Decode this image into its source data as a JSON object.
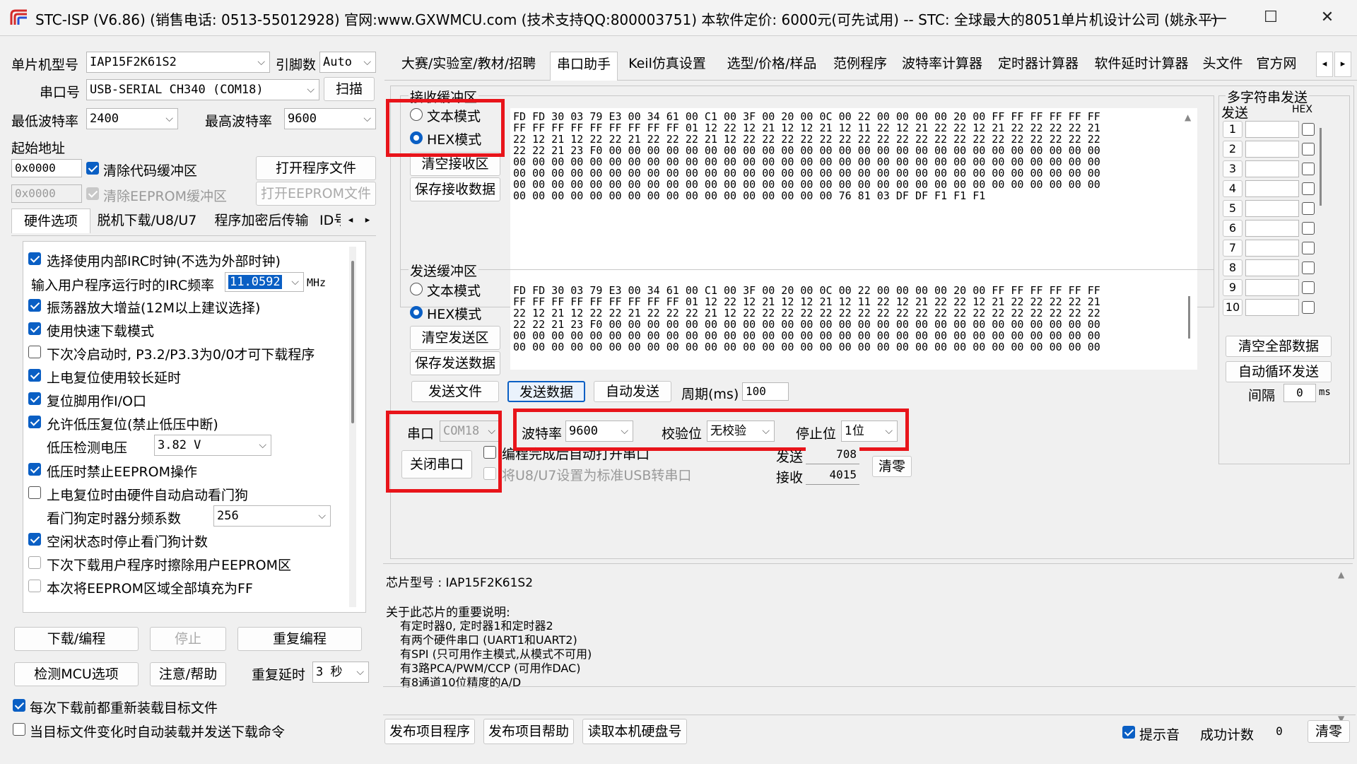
{
  "window": {
    "title": "STC-ISP (V6.86) (销售电话: 0513-55012928) 官网:www.GXWMCU.com  (技术支持QQ:800003751) 本软件定价: 6000元(可先试用) -- STC: 全球最大的8051单片机设计公司 (姚永平)",
    "minimize": "—",
    "maximize": "☐",
    "close": "✕"
  },
  "left": {
    "mcu_label": "单片机型号",
    "mcu_value": "IAP15F2K61S2",
    "pin_label": "引脚数",
    "pin_value": "Auto",
    "port_label": "串口号",
    "port_value": "USB-SERIAL CH340 (COM18)",
    "scan_button": "扫描",
    "min_baud_label": "最低波特率",
    "min_baud_value": "2400",
    "max_baud_label": "最高波特率",
    "max_baud_value": "9600",
    "start_addr_label": "起始地址",
    "addr1": "0x0000",
    "clear_code_label": "清除代码缓冲区",
    "open_program_button": "打开程序文件",
    "addr2": "0x0000",
    "clear_eeprom_label": "清除EEPROM缓冲区",
    "open_eeprom_button": "打开EEPROM文件",
    "tabs": [
      "硬件选项",
      "脱机下载/U8/U7",
      "程序加密后传输",
      "ID号"
    ],
    "options": [
      {
        "label": "选择使用内部IRC时钟(不选为外部时钟)",
        "checked": true
      },
      {
        "label": "振荡器放大增益(12M以上建议选择)",
        "checked": true
      },
      {
        "label": "使用快速下载模式",
        "checked": true
      },
      {
        "label": "下次冷启动时, P3.2/P3.3为0/0才可下载程序",
        "checked": false
      },
      {
        "label": "上电复位使用较长延时",
        "checked": true
      },
      {
        "label": "复位脚用作I/O口",
        "checked": true
      },
      {
        "label": "允许低压复位(禁止低压中断)",
        "checked": true
      },
      {
        "label": "低压时禁止EEPROM操作",
        "checked": true
      },
      {
        "label": "上电复位时由硬件自动启动看门狗",
        "checked": false
      },
      {
        "label": "空闲状态时停止看门狗计数",
        "checked": true
      },
      {
        "label": "下次下载用户程序时擦除用户EEPROM区",
        "checked": false
      },
      {
        "label": "本次将EEPROM区域全部填充为FF",
        "checked": false
      }
    ],
    "irc_label": "输入用户程序运行时的IRC频率",
    "irc_value": "11.0592",
    "irc_unit": "MHz",
    "lv_label": "低压检测电压",
    "lv_value": "3.82 V",
    "wdt_label": "看门狗定时器分频系数",
    "wdt_value": "256",
    "download_button": "下载/编程",
    "stop_button": "停止",
    "reprogram_button": "重复编程",
    "detect_button": "检测MCU选项",
    "help_button": "注意/帮助",
    "repeat_delay_label": "重复延时",
    "repeat_delay_value": "3 秒",
    "reload_label": "每次下载前都重新装载目标文件",
    "reload_checked": true,
    "autosend_label": "当目标文件变化时自动装载并发送下载命令",
    "autosend_checked": false
  },
  "right_tabs": [
    "大赛/实验室/教材/招聘",
    "串口助手",
    "Keil仿真设置",
    "选型/价格/样品",
    "范例程序",
    "波特率计算器",
    "定时器计算器",
    "软件延时计算器",
    "头文件",
    "官方网"
  ],
  "active_tab": 1,
  "receive": {
    "group_label": "接收缓冲区",
    "text_mode": "文本模式",
    "hex_mode": "HEX模式",
    "clear_button": "清空接收区",
    "save_button": "保存接收数据",
    "data": "FD FD 30 03 79 E3 00 34 61 00 C1 00 3F 00 20 00 0C 00 22 00 00 00 00 20 00 FF FF FF FF FF FF\nFF FF FF FF FF FF FF FF FF 01 12 22 12 21 12 12 21 12 11 22 12 21 22 22 12 21 22 22 22 22 21\n22 12 21 12 22 22 21 22 22 22 21 12 22 22 22 22 22 22 22 22 22 22 22 22 22 22 22 22 22 22 22\n22 22 21 23 F0 00 00 00 00 00 00 00 00 00 00 00 00 00 00 00 00 00 00 00 00 00 00 00 00 00 00\n00 00 00 00 00 00 00 00 00 00 00 00 00 00 00 00 00 00 00 00 00 00 00 00 00 00 00 00 00 00 00\n00 00 00 00 00 00 00 00 00 00 00 00 00 00 00 00 00 00 00 00 00 00 00 00 00 00 00 00 00 00 00\n00 00 00 00 00 00 00 00 00 00 00 00 00 00 00 00 00 00 00 00 00 00 00 00 00 00 00 00 00 00 00\n00 00 00 00 00 00 00 00 00 00 00 00 00 00 00 00 00 76 81 03 DF DF F1 F1 F1"
  },
  "send": {
    "group_label": "发送缓冲区",
    "text_mode": "文本模式",
    "hex_mode": "HEX模式",
    "clear_button": "清空发送区",
    "save_button": "保存发送数据",
    "data": "FD FD 30 03 79 E3 00 34 61 00 C1 00 3F 00 20 00 0C 00 22 00 00 00 00 20 00 FF FF FF FF FF FF\nFF FF FF FF FF FF FF FF FF 01 12 22 12 21 12 12 21 12 11 22 12 21 22 22 12 21 22 22 22 22 21\n22 12 21 12 22 22 21 22 22 22 21 12 22 22 22 22 22 22 22 22 22 22 22 22 22 22 22 22 22 22 22\n22 22 21 23 F0 00 00 00 00 00 00 00 00 00 00 00 00 00 00 00 00 00 00 00 00 00 00 00 00 00 00\n00 00 00 00 00 00 00 00 00 00 00 00 00 00 00 00 00 00 00 00 00 00 00 00 00 00 00 00 00 00 00\n00 00 00 00 00 00 00 00 00 00 00 00 00 00 00 00 00 00 00 00 00 00 00 00 00 00 00 00 00 00 00",
    "send_file_button": "发送文件",
    "send_data_button": "发送数据",
    "auto_send_button": "自动发送",
    "period_label": "周期(ms)",
    "period_value": "100"
  },
  "multi": {
    "title": "多字符串发送",
    "send_col": "发送",
    "hex_col": "HEX",
    "rows": [
      "1",
      "2",
      "3",
      "4",
      "5",
      "6",
      "7",
      "8",
      "9",
      "10"
    ],
    "clear_all_button": "清空全部数据",
    "loop_button": "自动循环发送",
    "interval_label": "间隔",
    "interval_value": "0",
    "interval_unit": "ms"
  },
  "serial": {
    "port_label": "串口",
    "port_value": "COM18",
    "close_button": "关闭串口",
    "baud_label": "波特率",
    "baud_value": "9600",
    "parity_label": "校验位",
    "parity_value": "无校验",
    "stop_label": "停止位",
    "stop_value": "1位",
    "auto_open_label": "编程完成后自动打开串口",
    "usb_label": "将U8/U7设置为标准USB转串口",
    "tx_label": "发送",
    "tx_value": "708",
    "rx_label": "接收",
    "rx_value": "4015",
    "clear_button": "清零"
  },
  "info": {
    "chip_line": "芯片型号 : IAP15F2K61S2",
    "notes_title": "关于此芯片的重要说明:",
    "notes": [
      "有定时器0, 定时器1和定时器2",
      "有两个硬件串口 (UART1和UART2)",
      "有SPI (只可用作主模式,从模式不可用)",
      "有3路PCA/PWM/CCP (可用作DAC)",
      "有8通道10位精度的A/D"
    ]
  },
  "bottom": {
    "publish_program": "发布项目程序",
    "publish_help": "发布项目帮助",
    "read_disk": "读取本机硬盘号",
    "beep_label": "提示音",
    "beep_checked": true,
    "success_label": "成功计数",
    "success_value": "0",
    "clear_button": "清零"
  }
}
